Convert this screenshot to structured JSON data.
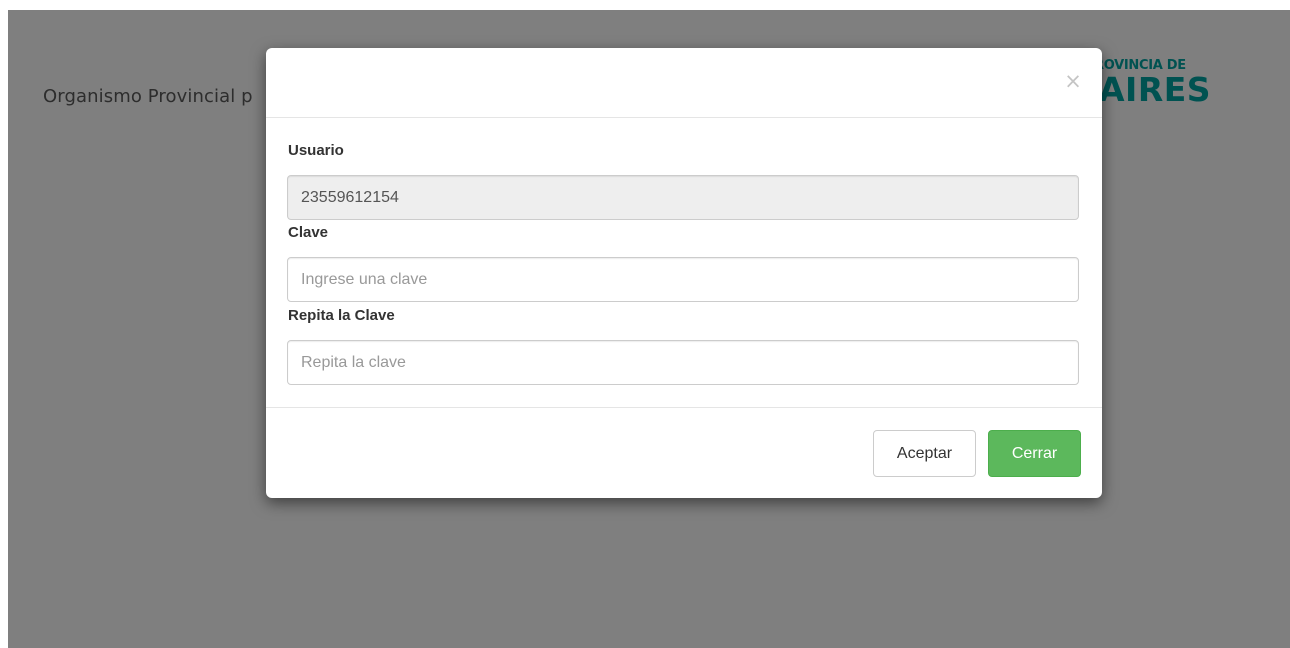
{
  "background": {
    "header_text": "Organismo Provincial p",
    "logo_top": "ROVINCIA DE",
    "logo_bottom": "AIRES",
    "brand_color": "#00a5a3"
  },
  "modal": {
    "close_icon": "×",
    "fields": [
      {
        "label": "Usuario",
        "value": "23559612154",
        "placeholder": "",
        "readonly": true
      },
      {
        "label": "Clave",
        "value": "",
        "placeholder": "Ingrese una clave",
        "readonly": false
      },
      {
        "label": "Repita la Clave",
        "value": "",
        "placeholder": "Repita la clave",
        "readonly": false
      }
    ],
    "footer": {
      "accept_label": "Aceptar",
      "close_label": "Cerrar",
      "close_button_color": "#5cb85c"
    }
  }
}
